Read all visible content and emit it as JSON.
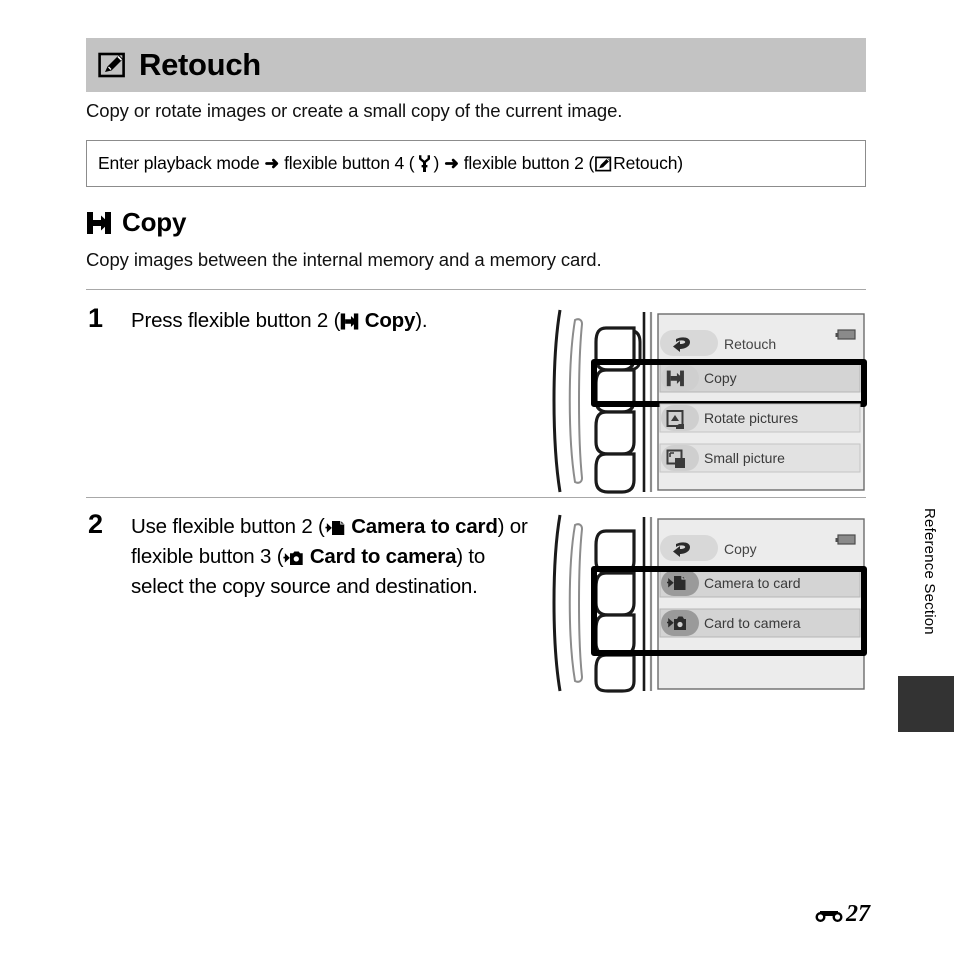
{
  "header": {
    "icon": "retouch-icon",
    "title": "Retouch"
  },
  "intro": "Copy or rotate images or create a small copy of the current image.",
  "breadcrumb": {
    "part1": "Enter playback mode",
    "arrow1": "➜",
    "part2": "flexible button 4 (",
    "icon1": "wrench-icon",
    "part3": ")",
    "arrow2": "➜",
    "part4": "flexible button 2 (",
    "icon2": "retouch-icon",
    "part5": " Retouch)"
  },
  "subsection": {
    "icon": "copy-icon",
    "title": "Copy",
    "description": "Copy images between the internal memory and a memory card."
  },
  "steps": [
    {
      "number": "1",
      "text_before": "Press flexible button 2 (",
      "icon": "copy-icon",
      "text_bold": "Copy",
      "text_after": ")."
    },
    {
      "number": "2",
      "seg1": "Use flexible button 2 (",
      "icon1": "camera-to-card-icon",
      "bold1": "Camera to card",
      "seg2": ") or flexible button 3 (",
      "icon2": "card-to-camera-icon",
      "bold2": "Card to camera",
      "seg3": ") to select the copy source and destination."
    }
  ],
  "figures": [
    {
      "name": "retouch-menu-screen",
      "battery_icon": "battery-icon",
      "header_item": {
        "icon": "back-arrow-icon",
        "label": "Retouch"
      },
      "items": [
        {
          "icon": "copy-icon",
          "label": "Copy",
          "highlighted": true
        },
        {
          "icon": "rotate-pictures-icon",
          "label": "Rotate pictures",
          "highlighted": false
        },
        {
          "icon": "small-picture-icon",
          "label": "Small picture",
          "highlighted": false
        }
      ],
      "buttons": [
        "flexible-button-1",
        "flexible-button-2",
        "flexible-button-3",
        "flexible-button-4"
      ],
      "highlighted_button_index": 1
    },
    {
      "name": "copy-menu-screen",
      "battery_icon": "battery-icon",
      "header_item": {
        "icon": "back-arrow-icon",
        "label": "Copy"
      },
      "items": [
        {
          "icon": "camera-to-card-icon",
          "label": "Camera to card",
          "highlighted": true
        },
        {
          "icon": "card-to-camera-icon",
          "label": "Card to camera",
          "highlighted": true
        }
      ],
      "buttons": [
        "flexible-button-1",
        "flexible-button-2",
        "flexible-button-3",
        "flexible-button-4"
      ],
      "highlighted_button_index": 1
    }
  ],
  "side_tab_label": "Reference Section",
  "footer": {
    "section_icon": "reference-section-icon",
    "page_number": "27"
  },
  "colors": {
    "header_bg": "#c3c3c3",
    "screen_bg": "#ececec",
    "item_bg": "#e2e2e2",
    "item_highlight_bg": "#d4d4d4",
    "icon_gray": "#6b6b6b",
    "tab_dark": "#333333",
    "rule": "#a8a8a8"
  }
}
